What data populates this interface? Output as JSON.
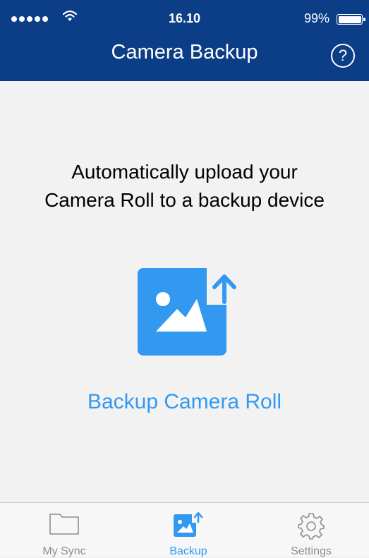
{
  "status_bar": {
    "time": "16.10",
    "battery": "99%"
  },
  "header": {
    "title": "Camera Backup",
    "help_label": "?"
  },
  "main": {
    "message_line1": "Automatically upload your",
    "message_line2": "Camera Roll to a backup device",
    "action_label": "Backup Camera Roll"
  },
  "tabs": [
    {
      "label": "My Sync",
      "icon": "folder-icon"
    },
    {
      "label": "Backup",
      "icon": "photo-upload-icon",
      "active": true
    },
    {
      "label": "Settings",
      "icon": "gear-icon"
    }
  ],
  "colors": {
    "header": "#0b3e86",
    "accent": "#3399f0",
    "background": "#f2f2f2"
  }
}
